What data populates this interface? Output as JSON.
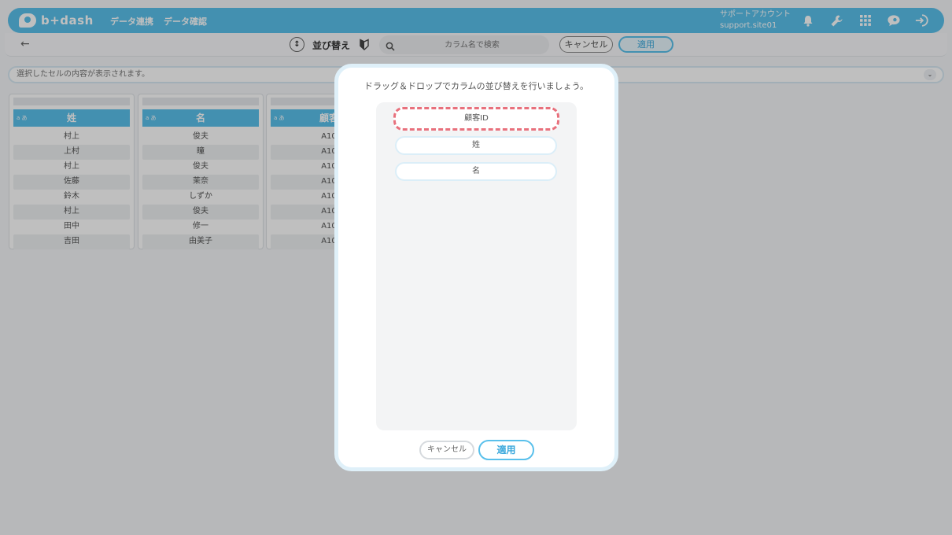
{
  "header": {
    "logo_text": "b+dash",
    "nav": [
      "データ連携",
      "データ確認"
    ],
    "account_label": "サポートアカウント",
    "account_id": "support.site01"
  },
  "toolbar": {
    "back_arrow": "←",
    "sort_icon_glyph": "↕",
    "title": "並び替え",
    "search_placeholder": "カラム名で検索",
    "cancel_label": "キャンセル",
    "apply_label": "適用"
  },
  "cell_bar": {
    "text": "選択したセルの内容が表示されます。",
    "chevron": "⌄"
  },
  "table": {
    "type_badge": "a あ",
    "columns": [
      {
        "header": "姓",
        "rows": [
          "村上",
          "上村",
          "村上",
          "佐藤",
          "鈴木",
          "村上",
          "田中",
          "吉田"
        ]
      },
      {
        "header": "名",
        "rows": [
          "俊夫",
          "瞳",
          "俊夫",
          "茉奈",
          "しずか",
          "俊夫",
          "修一",
          "由美子"
        ]
      },
      {
        "header": "顧客",
        "rows": [
          "A10",
          "A10",
          "A10",
          "A10",
          "A10",
          "A10",
          "A10",
          "A10"
        ]
      }
    ]
  },
  "modal": {
    "message": "ドラッグ＆ドロップでカラムの並び替えを行いましょう。",
    "items": [
      "顧客ID",
      "姓",
      "名"
    ],
    "cancel_label": "キャンセル",
    "apply_label": "適用"
  },
  "colors": {
    "accent": "#5ac0eb",
    "selected_dash": "#e8707c"
  }
}
